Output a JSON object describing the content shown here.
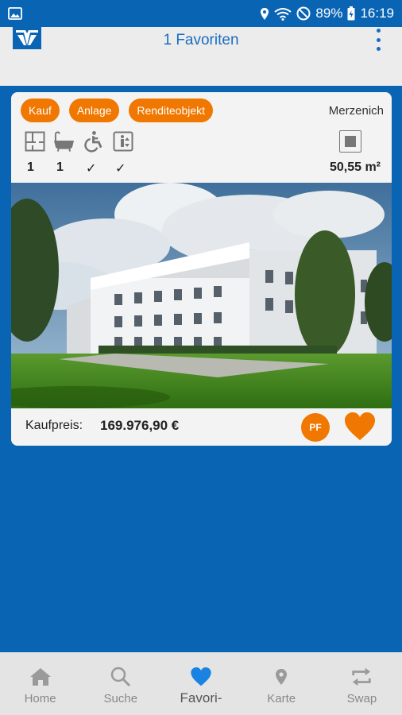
{
  "status_bar": {
    "battery": "89%",
    "time": "16:19"
  },
  "app_bar": {
    "title": "1 Favoriten"
  },
  "listing": {
    "tags": [
      "Kauf",
      "Anlage",
      "Renditeobjekt"
    ],
    "location": "Merzenich",
    "features": {
      "rooms": "1",
      "bathrooms": "1",
      "accessible": "✓",
      "elevator": "✓"
    },
    "area": "50,55 m²",
    "price_label": "Kaufpreis:",
    "price_value": "169.976,90 €",
    "pf_label": "PF"
  },
  "bottom_nav": [
    {
      "label": "Home",
      "icon": "home-icon"
    },
    {
      "label": "Suche",
      "icon": "search-icon"
    },
    {
      "label": "Favori-",
      "icon": "heart-icon",
      "active": true
    },
    {
      "label": "Karte",
      "icon": "map-pin-icon"
    },
    {
      "label": "Swap",
      "icon": "swap-icon"
    }
  ],
  "colors": {
    "primary": "#0a64b4",
    "accent": "#f07800",
    "appbar": "#ececec",
    "nav": "#e4e4e4"
  }
}
